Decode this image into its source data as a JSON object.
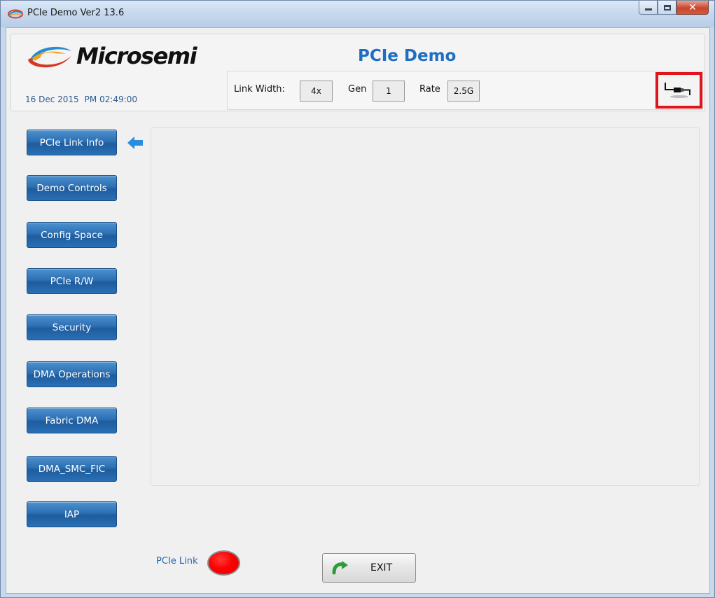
{
  "window": {
    "title": "PCIe Demo Ver2 13.6"
  },
  "header": {
    "logo_text": "Microsemi",
    "app_title": "PCIe Demo",
    "date": "16 Dec 2015",
    "time": "PM 02:49:00",
    "link_width_label": "Link Width:",
    "link_width_value": "4x",
    "gen_label": "Gen",
    "gen_value": "1",
    "rate_label": "Rate",
    "rate_value": "2.5G",
    "link_icon": "cable-plug-icon"
  },
  "sidebar": {
    "active_index": 0,
    "items": [
      {
        "label": "PCIe Link Info"
      },
      {
        "label": "Demo Controls"
      },
      {
        "label": "Config Space"
      },
      {
        "label": "PCIe R/W"
      },
      {
        "label": "Security"
      },
      {
        "label": "DMA Operations"
      },
      {
        "label": "Fabric DMA"
      },
      {
        "label": "DMA_SMC_FIC"
      },
      {
        "label": "IAP"
      }
    ]
  },
  "footer": {
    "pcie_link_label": "PCIe Link",
    "pcie_link_status_color": "#ff0000",
    "exit_label": "EXIT"
  },
  "colors": {
    "accent_blue": "#1e6fc3",
    "button_blue": "#2c6fb3",
    "highlight_red": "#e0141c"
  }
}
